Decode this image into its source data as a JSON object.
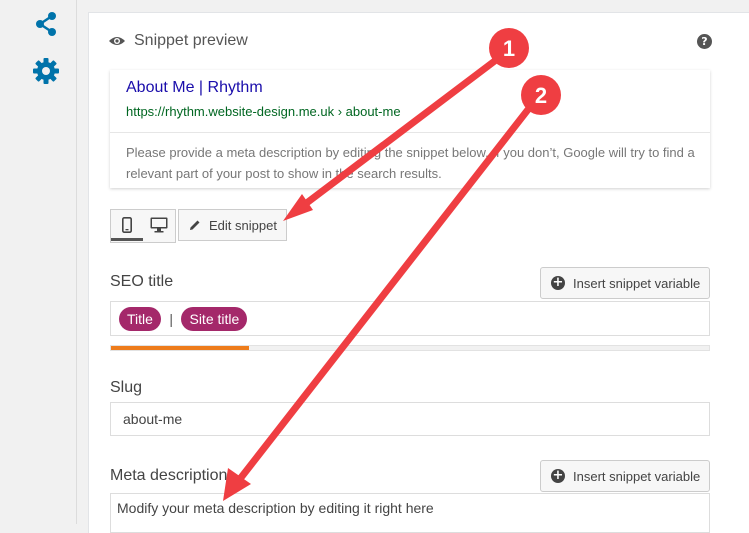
{
  "sidebar": {
    "icons": [
      "share-icon",
      "gear-icon"
    ]
  },
  "preview": {
    "header": "Snippet preview",
    "help": "?",
    "serp_title": "About Me | Rhythm",
    "serp_url": "https://rhythm.website-design.me.uk › about-me",
    "serp_description": "Please provide a meta description by editing the snippet below. If you don’t, Google will try to find a relevant part of your post to show in the search results."
  },
  "controls": {
    "mobile_icon": "mobile-icon",
    "desktop_icon": "desktop-icon",
    "edit_snippet": "Edit snippet"
  },
  "seo_title": {
    "label": "SEO title",
    "insert_variable": "Insert snippet variable",
    "pills": [
      "Title",
      "Site title"
    ],
    "separator": "|",
    "progress": 0.23,
    "progress_color": "#ee7c1b"
  },
  "slug": {
    "label": "Slug",
    "value": "about-me"
  },
  "meta_description": {
    "label": "Meta description",
    "insert_variable": "Insert snippet variable",
    "value": "Modify your meta description by editing it right here"
  },
  "annotations": {
    "badge_1": "1",
    "badge_2": "2",
    "color": "#ef3e42"
  },
  "colors": {
    "brand_purple": "#a4286a",
    "sidebar_icon": "#0073aa",
    "link": "#1a0dab",
    "url": "#006621"
  }
}
